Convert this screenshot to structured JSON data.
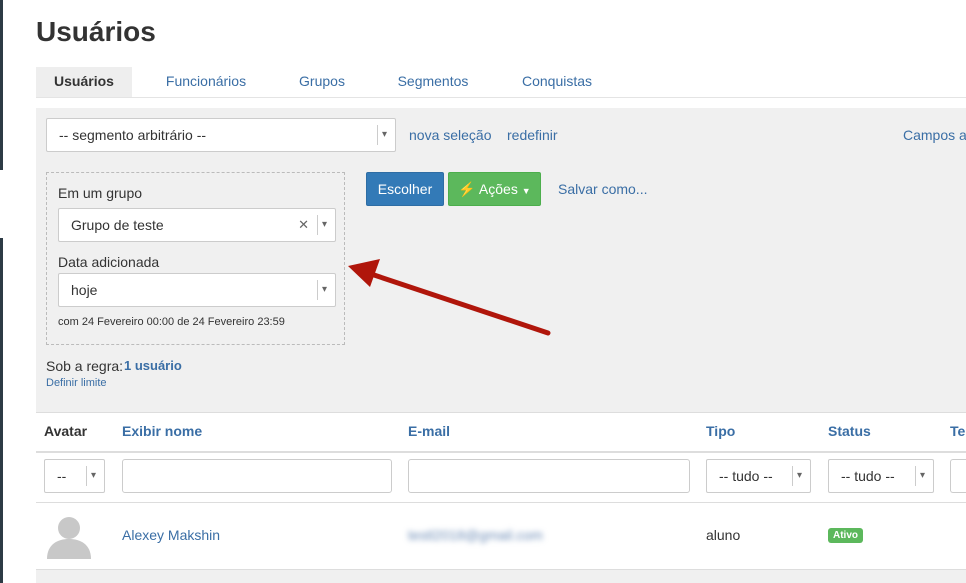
{
  "page": {
    "title": "Usuários"
  },
  "tabs": [
    {
      "label": "Usuários",
      "active": true
    },
    {
      "label": "Funcionários"
    },
    {
      "label": "Grupos"
    },
    {
      "label": "Segmentos"
    },
    {
      "label": "Conquistas"
    }
  ],
  "segment": {
    "selected": "-- segmento arbitrário --",
    "new_selection": "nova seleção",
    "reset": "redefinir",
    "fields_link": "Campos ad"
  },
  "filter": {
    "group_label": "Em um grupo",
    "group_value": "Grupo de teste",
    "date_label": "Data adicionada",
    "date_value": "hoje",
    "date_range": "com 24 Fevereiro 00:00 de 24 Fevereiro 23:59"
  },
  "actions": {
    "choose": "Escolher",
    "actions": "Ações",
    "save_as": "Salvar como..."
  },
  "rule": {
    "prefix": "Sob a regra:",
    "count": "1 usuário",
    "limit_link": "Definir limite"
  },
  "table": {
    "headers": [
      "Avatar",
      "Exibir nome",
      "E-mail",
      "Tipo",
      "Status",
      "Tel"
    ],
    "filters": {
      "avatar": "--",
      "tipo": "-- tudo --",
      "status": "-- tudo --"
    },
    "rows": [
      {
        "name": "Alexey Makshin",
        "email": "testl2018@gmail.com",
        "type": "aluno",
        "status": "Ativo"
      }
    ]
  },
  "colors": {
    "link": "#3a6ea5",
    "primary": "#337ab7",
    "success": "#5cb85c",
    "arrow": "#b0160b"
  }
}
